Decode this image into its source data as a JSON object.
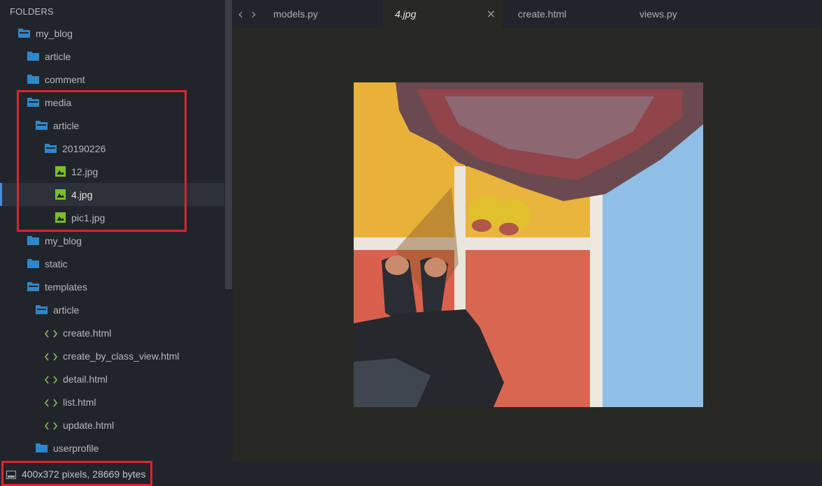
{
  "sidebar": {
    "header": "FOLDERS",
    "items": [
      {
        "label": "my_blog",
        "type": "folder-open"
      },
      {
        "label": "article",
        "type": "folder"
      },
      {
        "label": "comment",
        "type": "folder"
      },
      {
        "label": "media",
        "type": "folder-open"
      },
      {
        "label": "article",
        "type": "folder-open"
      },
      {
        "label": "20190226",
        "type": "folder-open"
      },
      {
        "label": "12.jpg",
        "type": "image-file"
      },
      {
        "label": "4.jpg",
        "type": "image-file",
        "selected": true
      },
      {
        "label": "pic1.jpg",
        "type": "image-file"
      },
      {
        "label": "my_blog",
        "type": "folder"
      },
      {
        "label": "static",
        "type": "folder"
      },
      {
        "label": "templates",
        "type": "folder-open"
      },
      {
        "label": "article",
        "type": "folder-open"
      },
      {
        "label": "create.html",
        "type": "html-file"
      },
      {
        "label": "create_by_class_view.html",
        "type": "html-file"
      },
      {
        "label": "detail.html",
        "type": "html-file"
      },
      {
        "label": "list.html",
        "type": "html-file"
      },
      {
        "label": "update.html",
        "type": "html-file"
      },
      {
        "label": "userprofile",
        "type": "folder"
      }
    ]
  },
  "tabs": [
    {
      "label": "models.py",
      "active": false
    },
    {
      "label": "4.jpg",
      "active": true,
      "close_icon": "close-icon"
    },
    {
      "label": "create.html",
      "active": false
    },
    {
      "label": "views.py",
      "active": false
    }
  ],
  "nav": {
    "back_icon": "chevron-left-icon",
    "forward_icon": "chevron-right-icon"
  },
  "viewer": {
    "image_subject": "feet in sandals on colored court"
  },
  "status": {
    "text": "400x372 pixels, 28669 bytes",
    "icon": "panel-icon"
  },
  "colors": {
    "folder": "#2f87c9",
    "image_icon": "#7bbf2a",
    "html_icon": "#8bc34a",
    "highlight_box": "#e0232b",
    "accent": "#4a8cd6"
  }
}
